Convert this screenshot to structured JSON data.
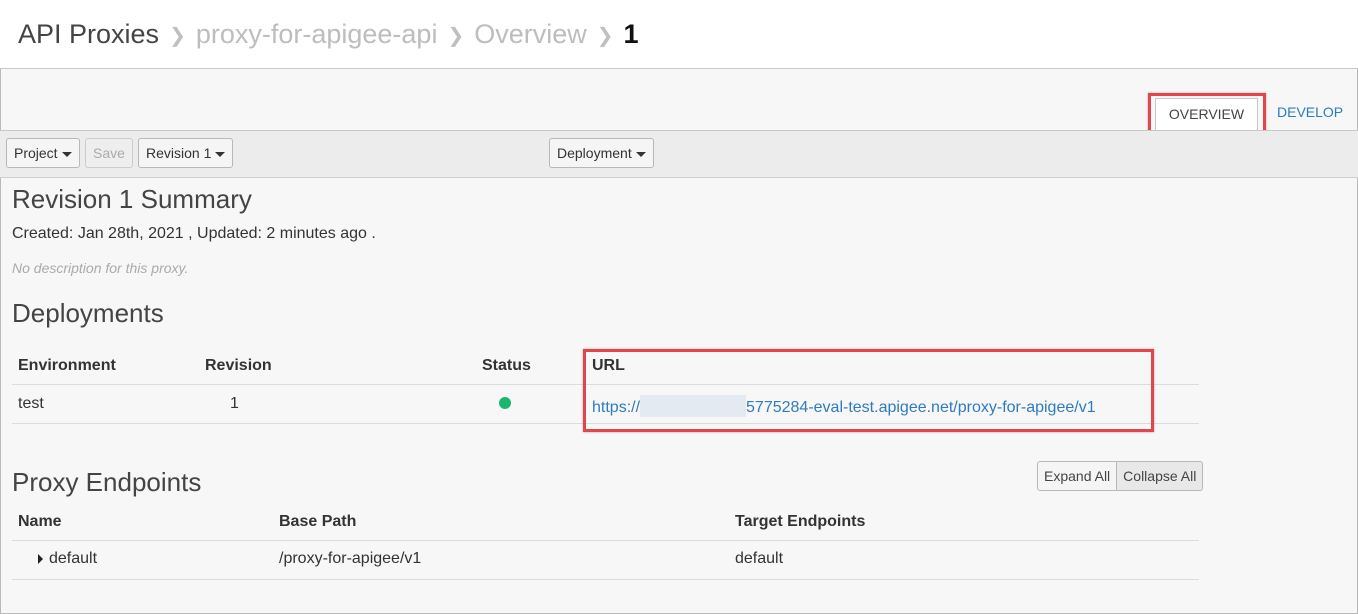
{
  "breadcrumb": {
    "root": "API Proxies",
    "proxy": "proxy-for-apigee-api",
    "section": "Overview",
    "revision": "1"
  },
  "tabs": {
    "overview": "OVERVIEW",
    "develop": "DEVELOP"
  },
  "toolbar": {
    "project": "Project",
    "save": "Save",
    "revision": "Revision 1",
    "deployment": "Deployment"
  },
  "summary": {
    "title": "Revision 1 Summary",
    "meta": "Created: Jan 28th, 2021 , Updated: 2 minutes ago .",
    "description": "No description for this proxy."
  },
  "deployments": {
    "title": "Deployments",
    "columns": [
      "Environment",
      "Revision",
      "Status",
      "URL"
    ],
    "rows": [
      {
        "environment": "test",
        "revision": "1",
        "status_color": "#1bb66e",
        "url_prefix": "https://",
        "url_suffix": "5775284-eval-test.apigee.net/proxy-for-apigee/v1"
      }
    ]
  },
  "endpoints": {
    "title": "Proxy Endpoints",
    "expand_all": "Expand All",
    "collapse_all": "Collapse All",
    "columns": [
      "Name",
      "Base Path",
      "Target Endpoints"
    ],
    "rows": [
      {
        "name": "default",
        "base_path": "/proxy-for-apigee/v1",
        "target": "default"
      }
    ]
  },
  "colors": {
    "link": "#2e7bbf",
    "highlight": "#e0474c",
    "status_ok": "#1bb66e"
  }
}
